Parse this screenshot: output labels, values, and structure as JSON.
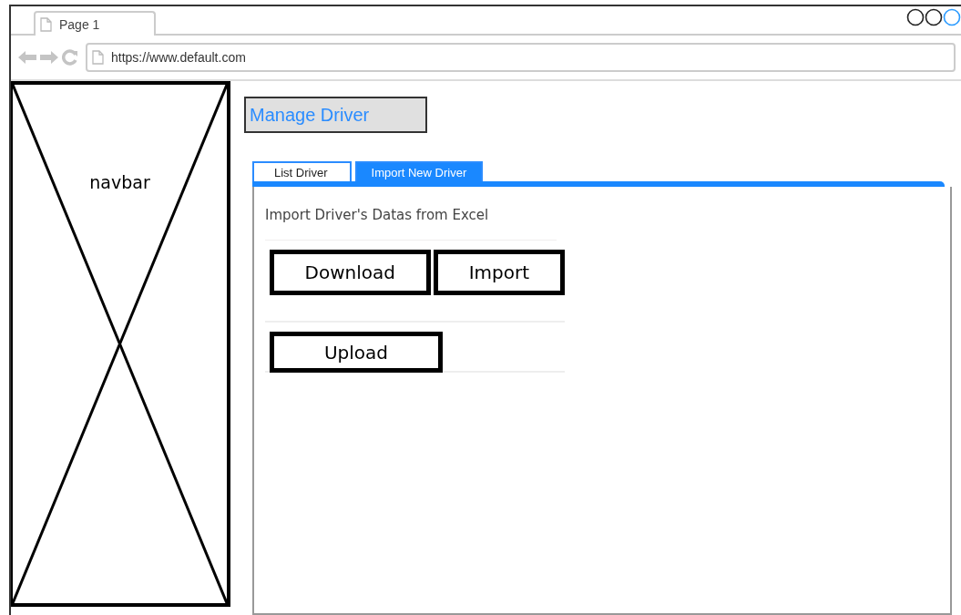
{
  "browser": {
    "tab_title": "Page 1",
    "url": "https://www.default.com"
  },
  "navbar": {
    "label": "navbar"
  },
  "page": {
    "title": "Manage Driver"
  },
  "tabs": [
    {
      "label": "List Driver",
      "selected": false
    },
    {
      "label": "Import New Driver",
      "selected": true
    }
  ],
  "panel": {
    "heading": "Import Driver's Datas from Excel",
    "button_rows": [
      [
        "Download",
        "Import"
      ],
      [
        "Upload"
      ]
    ]
  }
}
